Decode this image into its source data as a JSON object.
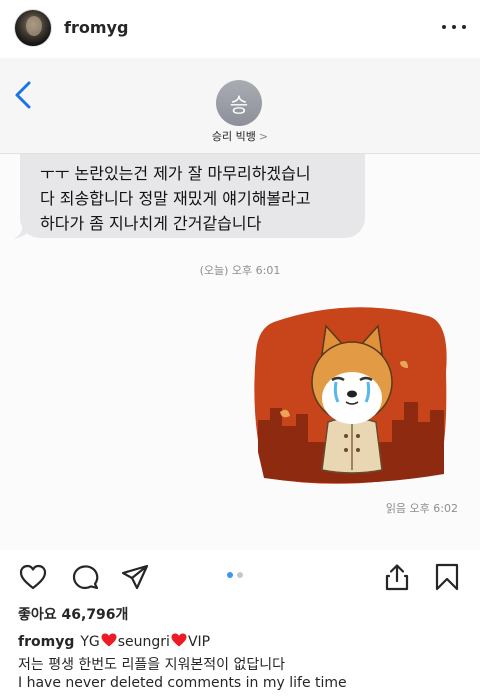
{
  "post": {
    "username": "fromyg"
  },
  "message": {
    "contact_initial": "승",
    "contact_name": "승리 빅뱅",
    "contact_chevron": ">",
    "bubble_lines": [
      "ㅜㅜ 논란있는건 제가 잘 마무리하겠습니",
      "다 죄송합니다 정말 재밌게 얘기해볼라고",
      "하다가 좀 지나치게 간거같습니다"
    ],
    "sent_time": "(오늘) 오후 6:01",
    "read_time": "읽음 오후 6:02"
  },
  "actions": {
    "icons": [
      "heart-icon",
      "comment-icon",
      "share-icon",
      "upload-icon",
      "bookmark-icon"
    ],
    "carousel_pages": 2,
    "carousel_active": 1
  },
  "likes": "좋아요 46,796개",
  "caption": {
    "username": "fromyg",
    "part_yg": "YG",
    "part_seungri": "seungri",
    "part_vip": "VIP",
    "line_korean": "저는 평생 한번도 리플을 지워본적이 없답니다",
    "line_english": "I have never deleted comments in my life time"
  },
  "colors": {
    "accent_blue": "#3897f0",
    "heart_red": "#ed1c24",
    "sticker_orange": "#c8441a"
  }
}
